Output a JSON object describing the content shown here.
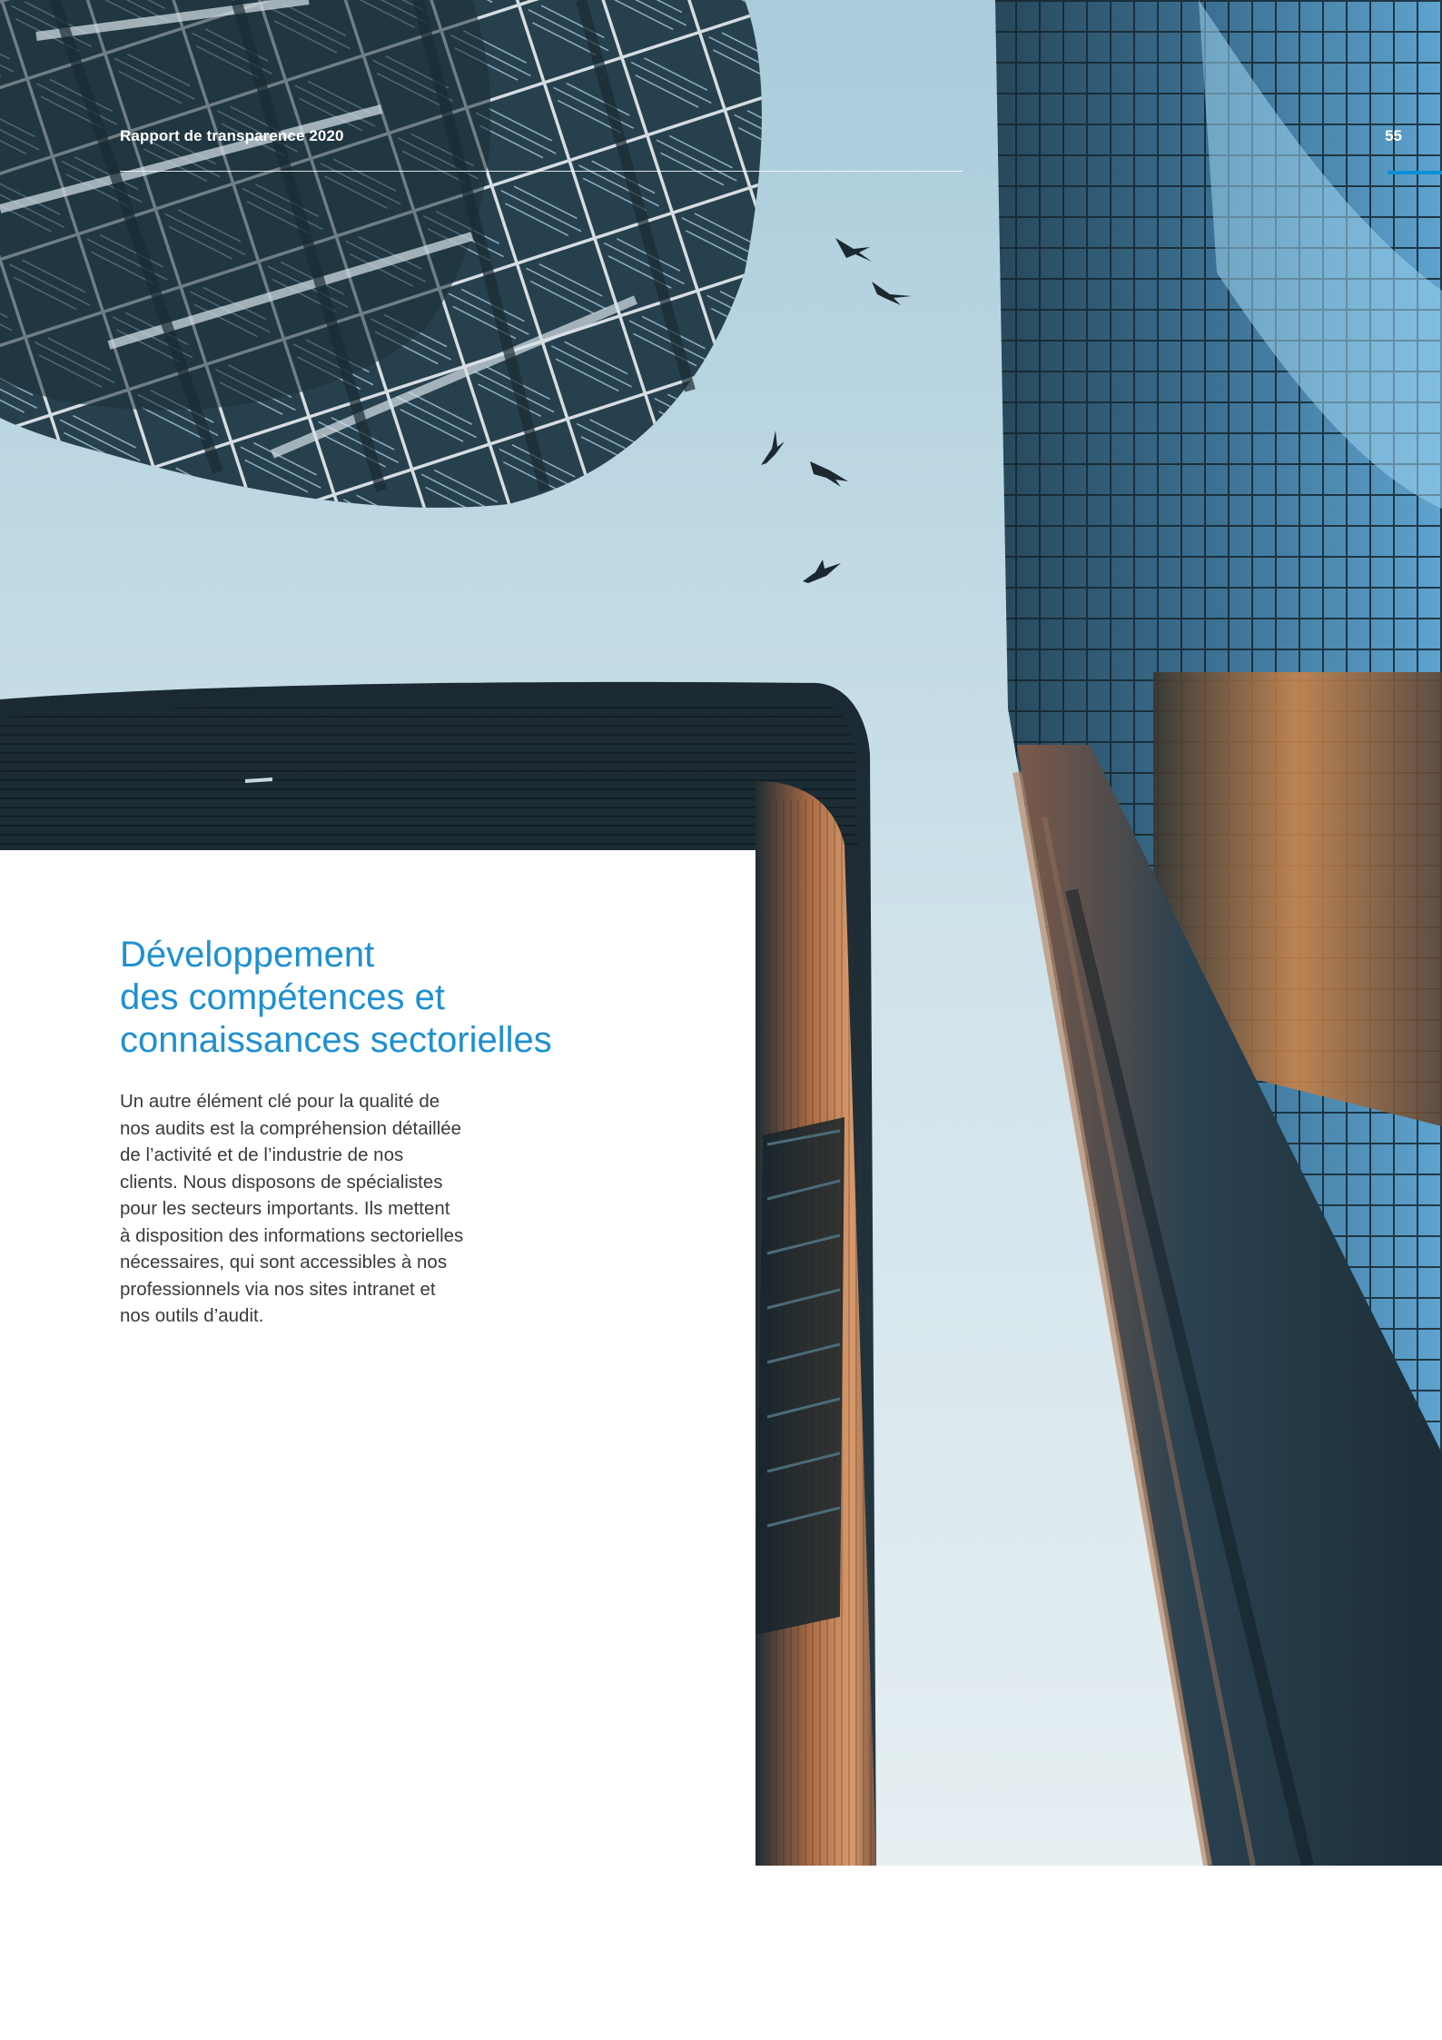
{
  "header": {
    "title": "Rapport de transparence 2020",
    "page_number": "55"
  },
  "section": {
    "title_lines": [
      "Développement",
      "des compétences et",
      "connaissances sectorielles"
    ],
    "body_lines": [
      "Un autre élément clé pour la qualité de",
      "nos audits est la compréhension détaillée",
      "de l’activité et de l’industrie de nos",
      "clients. Nous disposons de spécialistes",
      "pour les secteurs importants. Ils mettent",
      "à disposition des informations sectorielles",
      "nécessaires, qui sont accessibles à nos",
      "professionnels via nos sites intranet et",
      "nos outils d’audit."
    ]
  },
  "colors": {
    "accent": "#1e90d0",
    "accent_tab": "#0a8fd6",
    "body_text": "#3a3a3a",
    "sky": "#b8d6e4"
  },
  "image": {
    "subject": "upward view of glass office towers with birds in the sky"
  }
}
